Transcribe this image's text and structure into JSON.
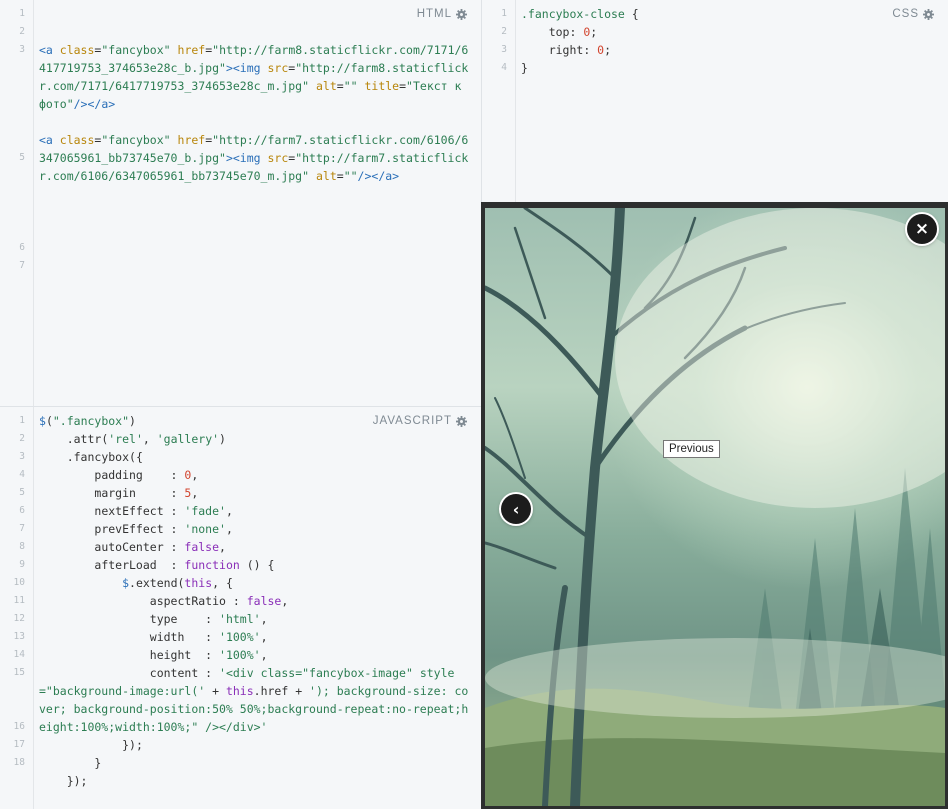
{
  "html_pane": {
    "label": "HTML",
    "line_numbers": [
      "1",
      "2",
      "3",
      "",
      "",
      "",
      "5",
      "",
      "",
      "",
      "6",
      "7"
    ],
    "lines": [
      [],
      [],
      [
        {
          "c": "t-tag",
          "t": "<a "
        },
        {
          "c": "t-attr",
          "t": "class"
        },
        {
          "c": "",
          "t": "="
        },
        {
          "c": "t-str",
          "t": "\"fancybox\""
        },
        {
          "c": "",
          "t": " "
        },
        {
          "c": "t-attr",
          "t": "href"
        },
        {
          "c": "",
          "t": "="
        },
        {
          "c": "t-str",
          "t": "\"http://farm8.staticflickr.com/7171/6417719753_374653e28c_b.jpg\""
        },
        {
          "c": "t-tag",
          "t": "><img "
        },
        {
          "c": "t-attr",
          "t": "src"
        },
        {
          "c": "",
          "t": "="
        },
        {
          "c": "t-str",
          "t": "\"http://farm8.staticflickr.com/7171/6417719753_374653e28c_m.jpg\""
        },
        {
          "c": "",
          "t": " "
        },
        {
          "c": "t-attr",
          "t": "alt"
        },
        {
          "c": "",
          "t": "="
        },
        {
          "c": "t-str",
          "t": "\"\""
        },
        {
          "c": "",
          "t": " "
        },
        {
          "c": "t-attr",
          "t": "title"
        },
        {
          "c": "",
          "t": "="
        },
        {
          "c": "t-str",
          "t": "\"Текст к фото\""
        },
        {
          "c": "t-tag",
          "t": "/></a>"
        }
      ],
      [],
      [
        {
          "c": "t-tag",
          "t": "<a "
        },
        {
          "c": "t-attr",
          "t": "class"
        },
        {
          "c": "",
          "t": "="
        },
        {
          "c": "t-str",
          "t": "\"fancybox\""
        },
        {
          "c": "",
          "t": " "
        },
        {
          "c": "t-attr",
          "t": "href"
        },
        {
          "c": "",
          "t": "="
        },
        {
          "c": "t-str",
          "t": "\"http://farm7.staticflickr.com/6106/6347065961_bb73745e70_b.jpg\""
        },
        {
          "c": "t-tag",
          "t": "><img "
        },
        {
          "c": "t-attr",
          "t": "src"
        },
        {
          "c": "",
          "t": "="
        },
        {
          "c": "t-str",
          "t": "\"http://farm7.staticflickr.com/6106/6347065961_bb73745e70_m.jpg\""
        },
        {
          "c": "",
          "t": " "
        },
        {
          "c": "t-attr",
          "t": "alt"
        },
        {
          "c": "",
          "t": "="
        },
        {
          "c": "t-str",
          "t": "\"\""
        },
        {
          "c": "t-tag",
          "t": "/></a>"
        }
      ],
      [],
      []
    ]
  },
  "css_pane": {
    "label": "CSS",
    "line_numbers": [
      "1",
      "2",
      "3",
      "4"
    ],
    "lines": [
      [
        {
          "c": "t-str",
          "t": ".fancybox-close"
        },
        {
          "c": "",
          "t": " {"
        }
      ],
      [
        {
          "c": "",
          "t": "    top: "
        },
        {
          "c": "t-num",
          "t": "0"
        },
        {
          "c": "",
          "t": ";"
        }
      ],
      [
        {
          "c": "",
          "t": "    right: "
        },
        {
          "c": "t-num",
          "t": "0"
        },
        {
          "c": "",
          "t": ";"
        }
      ],
      [
        {
          "c": "",
          "t": "}"
        }
      ]
    ]
  },
  "js_pane": {
    "label": "JAVASCRIPT",
    "line_numbers": [
      "1",
      "2",
      "3",
      "4",
      "5",
      "6",
      "7",
      "8",
      "9",
      "10",
      "11",
      "12",
      "13",
      "14",
      "15",
      "",
      "",
      "16",
      "17",
      "18"
    ],
    "lines": [
      [
        {
          "c": "t-var",
          "t": "$"
        },
        {
          "c": "",
          "t": "("
        },
        {
          "c": "t-str",
          "t": "\".fancybox\""
        },
        {
          "c": "",
          "t": ")"
        }
      ],
      [
        {
          "c": "",
          "t": "    .attr("
        },
        {
          "c": "t-str",
          "t": "'rel'"
        },
        {
          "c": "",
          "t": ", "
        },
        {
          "c": "t-str",
          "t": "'gallery'"
        },
        {
          "c": "",
          "t": ")"
        }
      ],
      [
        {
          "c": "",
          "t": "    .fancybox({"
        }
      ],
      [
        {
          "c": "",
          "t": "        padding    : "
        },
        {
          "c": "t-num",
          "t": "0"
        },
        {
          "c": "",
          "t": ","
        }
      ],
      [
        {
          "c": "",
          "t": "        margin     : "
        },
        {
          "c": "t-num",
          "t": "5"
        },
        {
          "c": "",
          "t": ","
        }
      ],
      [
        {
          "c": "",
          "t": "        nextEffect : "
        },
        {
          "c": "t-str",
          "t": "'fade'"
        },
        {
          "c": "",
          "t": ","
        }
      ],
      [
        {
          "c": "",
          "t": "        prevEffect : "
        },
        {
          "c": "t-str",
          "t": "'none'"
        },
        {
          "c": "",
          "t": ","
        }
      ],
      [
        {
          "c": "",
          "t": "        autoCenter : "
        },
        {
          "c": "t-kw",
          "t": "false"
        },
        {
          "c": "",
          "t": ","
        }
      ],
      [
        {
          "c": "",
          "t": "        afterLoad  : "
        },
        {
          "c": "t-kw",
          "t": "function"
        },
        {
          "c": "",
          "t": " () {"
        }
      ],
      [
        {
          "c": "",
          "t": "            "
        },
        {
          "c": "t-var",
          "t": "$"
        },
        {
          "c": "",
          "t": ".extend("
        },
        {
          "c": "t-kw",
          "t": "this"
        },
        {
          "c": "",
          "t": ", {"
        }
      ],
      [
        {
          "c": "",
          "t": "                aspectRatio : "
        },
        {
          "c": "t-kw",
          "t": "false"
        },
        {
          "c": "",
          "t": ","
        }
      ],
      [
        {
          "c": "",
          "t": "                type    : "
        },
        {
          "c": "t-str",
          "t": "'html'"
        },
        {
          "c": "",
          "t": ","
        }
      ],
      [
        {
          "c": "",
          "t": "                width   : "
        },
        {
          "c": "t-str",
          "t": "'100%'"
        },
        {
          "c": "",
          "t": ","
        }
      ],
      [
        {
          "c": "",
          "t": "                height  : "
        },
        {
          "c": "t-str",
          "t": "'100%'"
        },
        {
          "c": "",
          "t": ","
        }
      ],
      [
        {
          "c": "",
          "t": "                content : "
        },
        {
          "c": "t-str",
          "t": "'<div class=\"fancybox-image\" style=\"background-image:url('"
        },
        {
          "c": "",
          "t": " + "
        },
        {
          "c": "t-kw",
          "t": "this"
        },
        {
          "c": "",
          "t": ".href + "
        },
        {
          "c": "t-str",
          "t": "'); background-size: cover; background-position:50% 50%;background-repeat:no-repeat;height:100%;width:100%;\" /></div>'"
        }
      ],
      [
        {
          "c": "",
          "t": "            });"
        }
      ],
      [
        {
          "c": "",
          "t": "        }"
        }
      ],
      [
        {
          "c": "",
          "t": "    });"
        }
      ]
    ]
  },
  "lightbox": {
    "close_label": "×",
    "prev_label": "‹",
    "tooltip": "Previous"
  }
}
